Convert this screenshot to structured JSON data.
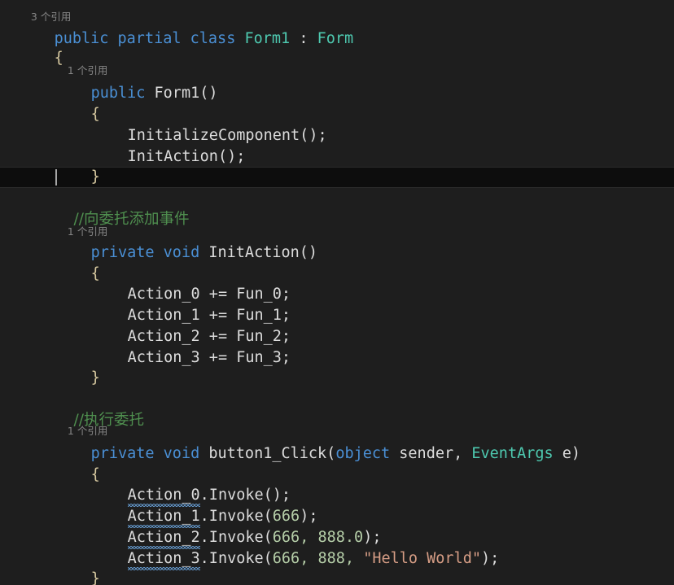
{
  "editor": {
    "language": "csharp",
    "theme": "dark",
    "background_color": "#1e1e1e",
    "current_line_color": "#0d0d0d",
    "colors": {
      "keyword": "#4a8fd4",
      "type": "#4ec9b0",
      "comment": "#4f8f4f",
      "number": "#b5cea8",
      "string": "#d69d85",
      "plain_text": "#dcdcdc",
      "codelens": "#868686",
      "brace": "#d7c9a0",
      "squiggle": "#5e8fbf",
      "caret": "#a6a6a6"
    }
  },
  "codelens": {
    "class_refs": "3 个引用",
    "ctor_refs": "1 个引用",
    "initaction_refs": "1 个引用",
    "buttonclick_refs": "1 个引用"
  },
  "code": {
    "class_decl": {
      "kw_public": "public",
      "kw_partial": "partial",
      "kw_class": "class",
      "name": "Form1",
      "colon": ":",
      "base": "Form"
    },
    "brace_open": "{",
    "brace_close": "}",
    "ctor": {
      "kw_public": "public",
      "name": "Form1()"
    },
    "ctor_body": {
      "line1": "InitializeComponent();",
      "line2": "InitAction();"
    },
    "comment_add_events": "//向委托添加事件",
    "initaction": {
      "kw_private": "private",
      "kw_void": "void",
      "name": "InitAction()"
    },
    "subscriptions": [
      "Action_0 += Fun_0;",
      "Action_1 += Fun_1;",
      "Action_2 += Fun_2;",
      "Action_3 += Fun_3;"
    ],
    "comment_exec": "//执行委托",
    "buttonclick": {
      "kw_private": "private",
      "kw_void": "void",
      "name": "button1_Click(",
      "param_type_1": "object",
      "param_name_1": "sender,",
      "param_type_2": "EventArgs",
      "param_name_2": "e)"
    },
    "invocations": [
      {
        "target": "Action_0",
        "dot_invoke": ".Invoke(",
        "args": [],
        "close": ");"
      },
      {
        "target": "Action_1",
        "dot_invoke": ".Invoke(",
        "args": [
          "666"
        ],
        "close": ");"
      },
      {
        "target": "Action_2",
        "dot_invoke": ".Invoke(",
        "args": [
          "666,",
          "888.0"
        ],
        "close": ");"
      },
      {
        "target": "Action_3",
        "dot_invoke": ".Invoke(",
        "args": [
          "666,",
          "888,"
        ],
        "string_arg": "\"Hello World\"",
        "close": ");"
      }
    ]
  }
}
